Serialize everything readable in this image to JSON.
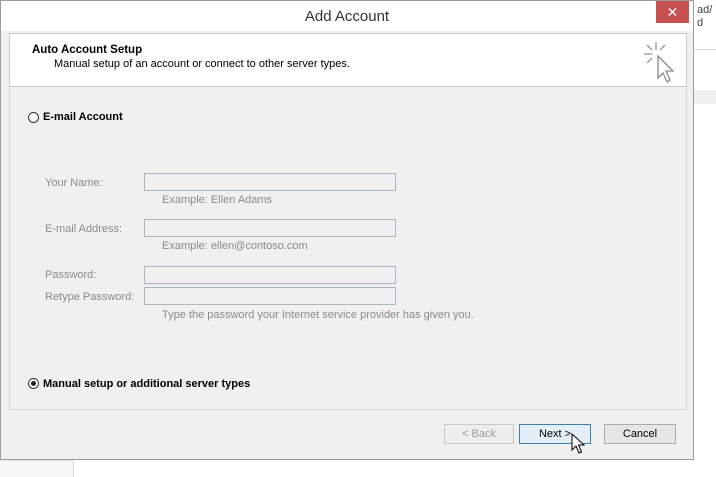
{
  "background": {
    "right_text_line1": "ad/",
    "right_text_line2": "d"
  },
  "dialog": {
    "title": "Add Account",
    "close_glyph": "✕",
    "header": {
      "title": "Auto Account Setup",
      "subtitle": "Manual setup of an account or connect to other server types.",
      "icon": "cursor-sparkle-icon"
    },
    "email_option": {
      "label": "E-mail Account",
      "selected": false
    },
    "fields": {
      "name_label": "Your Name:",
      "name_value": "",
      "name_hint": "Example: Ellen Adams",
      "email_label": "E-mail Address:",
      "email_value": "",
      "email_hint": "Example: ellen@contoso.com",
      "password_label": "Password:",
      "password_value": "",
      "retype_label": "Retype Password:",
      "retype_value": "",
      "password_hint": "Type the password your Internet service provider has given you."
    },
    "manual_option": {
      "label": "Manual setup or additional server types",
      "selected": true
    },
    "buttons": {
      "back": "< Back",
      "next": "Next >",
      "cancel": "Cancel"
    }
  },
  "colors": {
    "close_red": "#c75050",
    "next_border_blue": "#3c7fb1",
    "field_border": "#a8b5c7"
  }
}
